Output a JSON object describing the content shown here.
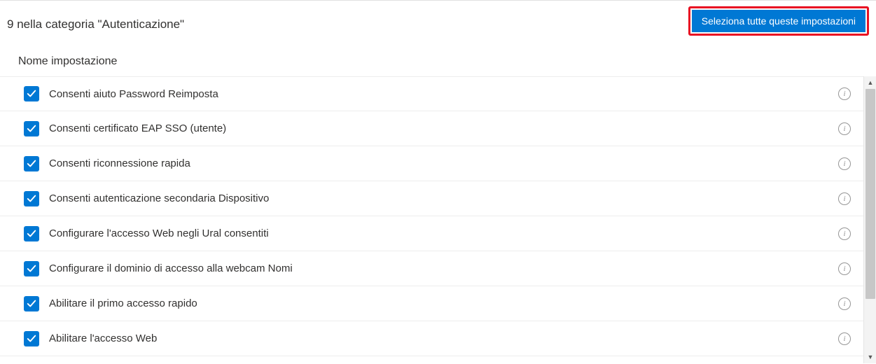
{
  "header": {
    "count": "9",
    "category_text": "nella categoria \"Autenticazione\"",
    "select_all_label": "Seleziona tutte queste impostazioni"
  },
  "column_header": "Nome impostazione",
  "rows": [
    {
      "label": "Consenti aiuto  Password  Reimposta"
    },
    {
      "label": "Consenti certificato EAP SSO (utente)"
    },
    {
      "label": "Consenti riconnessione rapida"
    },
    {
      "label": "Consenti autenticazione secondaria   Dispositivo"
    },
    {
      "label": "Configurare l'accesso Web negli Ural consentiti"
    },
    {
      "label": "Configurare il dominio di accesso alla webcam  Nomi"
    },
    {
      "label": "Abilitare il primo accesso rapido"
    },
    {
      "label": "Abilitare l'accesso Web"
    }
  ],
  "icons": {
    "info_glyph": "i",
    "scroll_up": "▲",
    "scroll_down": "▼"
  }
}
